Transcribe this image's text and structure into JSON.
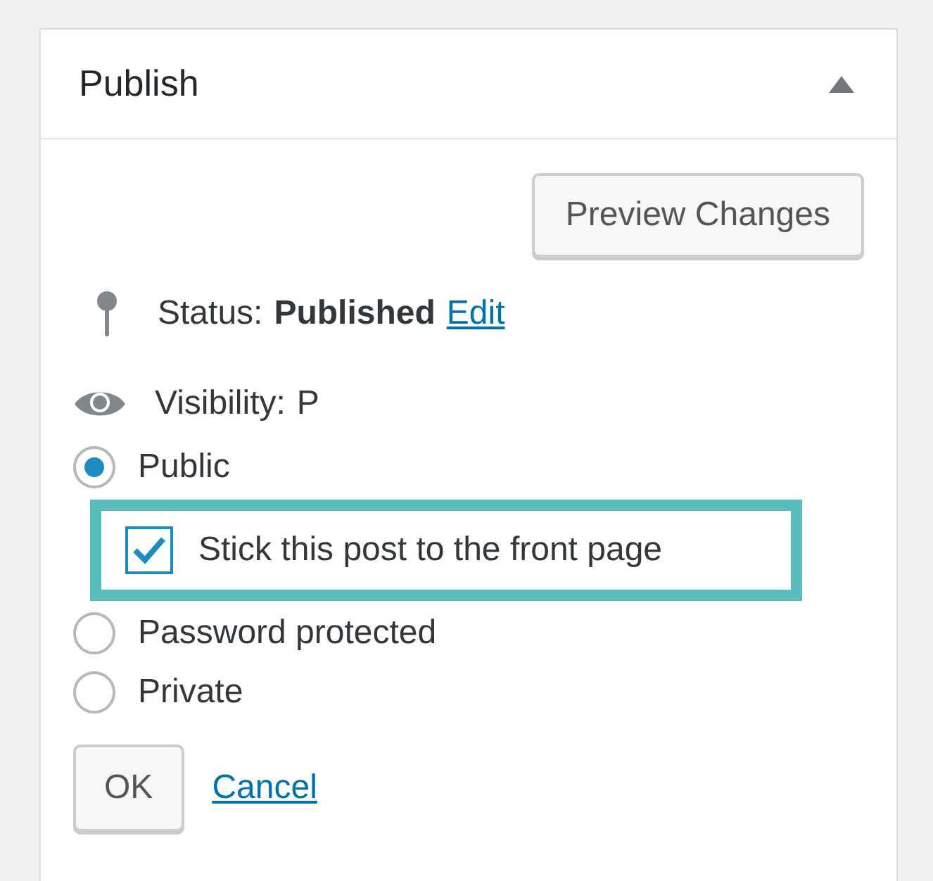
{
  "panel": {
    "title": "Publish",
    "collapsed": false
  },
  "preview_button": "Preview Changes",
  "status": {
    "label": "Status:",
    "value": "Published",
    "edit_link": "Edit"
  },
  "visibility": {
    "label": "Visibility:",
    "value": "P"
  },
  "visibility_options": [
    {
      "label": "Public",
      "selected": true
    },
    {
      "label": "Password protected",
      "selected": false
    },
    {
      "label": "Private",
      "selected": false
    }
  ],
  "sticky": {
    "label": "Stick this post to the front page",
    "checked": true
  },
  "ok_button": "OK",
  "cancel_link": "Cancel"
}
